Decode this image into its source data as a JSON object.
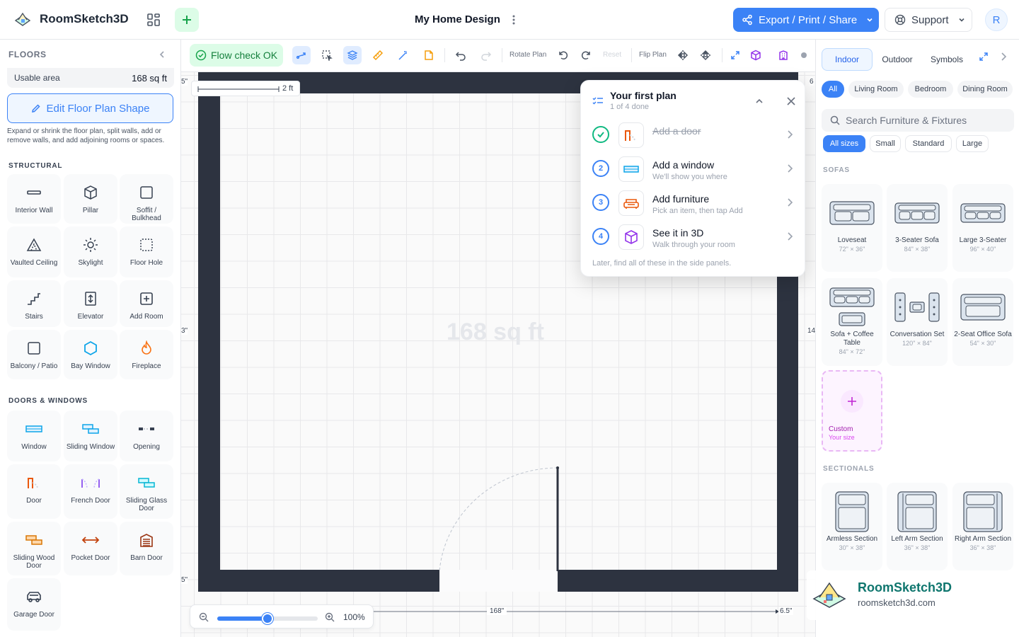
{
  "app": {
    "name": "RoomSketch3D",
    "doc_title": "My Home Design",
    "user_initial": "R"
  },
  "header": {
    "export_label": "Export / Print / Share",
    "support_label": "Support"
  },
  "left": {
    "title": "FLOORS",
    "usable_label": "Usable area",
    "usable_value": "168 sq ft",
    "edit_shape_label": "Edit Floor Plan Shape",
    "edit_desc": "Expand or shrink the floor plan, split walls, add or remove walls, and add adjoining rooms or spaces.",
    "structural_title": "STRUCTURAL",
    "structural": [
      "Interior Wall",
      "Pillar",
      "Soffit / Bulkhead",
      "Vaulted Ceiling",
      "Skylight",
      "Floor Hole",
      "Stairs",
      "Elevator",
      "Add Room",
      "Balcony / Patio",
      "Bay Window",
      "Fireplace"
    ],
    "doors_title": "DOORS & WINDOWS",
    "doors": [
      "Window",
      "Sliding Window",
      "Opening",
      "Door",
      "French Door",
      "Sliding Glass Door",
      "Sliding Wood Door",
      "Pocket Door",
      "Barn Door",
      "Garage Door"
    ]
  },
  "toolbar": {
    "flow_label": "Flow check OK",
    "rotate_label": "Rotate Plan",
    "reset_label": "Reset",
    "flip_label": "Flip Plan"
  },
  "canvas": {
    "area_label": "168 sq ft",
    "scale_label": "2 ft",
    "dim_bottom": "168\"",
    "dim_corner": "6.5\"",
    "edge_marks": [
      "5\"",
      "3\"",
      "5\"",
      "6",
      "14"
    ]
  },
  "checklist": {
    "title": "Your first plan",
    "progress": "1 of 4 done",
    "steps": [
      {
        "num": "",
        "title": "Add a door",
        "sub": "",
        "done": true
      },
      {
        "num": "2",
        "title": "Add a window",
        "sub": "We'll show you where",
        "done": false
      },
      {
        "num": "3",
        "title": "Add furniture",
        "sub": "Pick an item, then tap Add",
        "done": false
      },
      {
        "num": "4",
        "title": "See it in 3D",
        "sub": "Walk through your room",
        "done": false
      }
    ],
    "footer": "Later, find all of these in the side panels."
  },
  "zoom": {
    "percent_label": "100%",
    "level": 0.5
  },
  "right": {
    "tabs": [
      "Indoor",
      "Outdoor",
      "Symbols"
    ],
    "categories": [
      "All",
      "Living Room",
      "Bedroom",
      "Dining Room"
    ],
    "search_placeholder": "Search Furniture & Fixtures",
    "sizes": [
      "All sizes",
      "Small",
      "Standard",
      "Large"
    ],
    "sofas_title": "SOFAS",
    "sofas": [
      {
        "name": "Loveseat",
        "size": "72\" × 36\""
      },
      {
        "name": "3-Seater Sofa",
        "size": "84\" × 38\""
      },
      {
        "name": "Large 3-Seater",
        "size": "96\" × 40\""
      },
      {
        "name": "Sofa + Coffee Table",
        "size": "84\" × 72\""
      },
      {
        "name": "Conversation Set",
        "size": "120\" × 84\""
      },
      {
        "name": "2-Seat Office Sofa",
        "size": "54\" × 30\""
      }
    ],
    "custom_label": "Custom",
    "custom_sub": "Your size",
    "sectionals_title": "SECTIONALS",
    "sectionals": [
      {
        "name": "Armless Section",
        "size": "30\" × 38\""
      },
      {
        "name": "Left Arm Section",
        "size": "36\" × 38\""
      },
      {
        "name": "Right Arm Section",
        "size": "36\" × 38\""
      }
    ]
  },
  "watermark": {
    "title": "RoomSketch3D",
    "url": "roomsketch3d.com"
  },
  "colors": {
    "accent": "#3b82f6",
    "wall": "#2d3340",
    "success": "#10b981",
    "brand_watermark": "#0f766e"
  }
}
